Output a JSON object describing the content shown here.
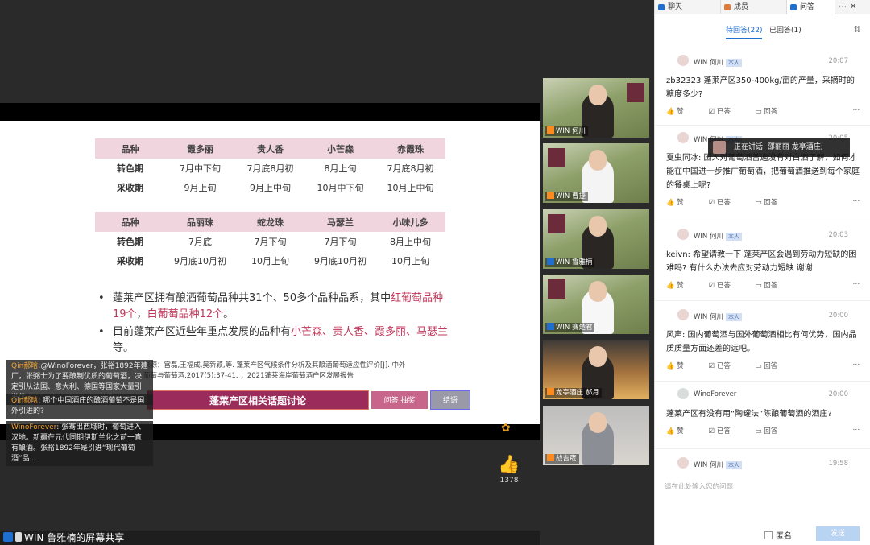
{
  "slide": {
    "table1": {
      "header": [
        "品种",
        "霞多丽",
        "贵人香",
        "小芒森",
        "赤霞珠"
      ],
      "rows": [
        [
          "转色期",
          "7月中下旬",
          "7月底8月初",
          "8月上旬",
          "7月底8月初"
        ],
        [
          "采收期",
          "9月上旬",
          "9月上中旬",
          "10月中下旬",
          "10月上中旬"
        ]
      ]
    },
    "table2": {
      "header": [
        "品种",
        "品丽珠",
        "蛇龙珠",
        "马瑟兰",
        "小味儿多"
      ],
      "rows": [
        [
          "转色期",
          "7月底",
          "7月下旬",
          "7月下旬",
          "8月上中旬"
        ],
        [
          "采收期",
          "9月底10月初",
          "10月上旬",
          "9月底10月初",
          "10月上旬"
        ]
      ]
    },
    "bullet1_a": "蓬莱产区拥有酿酒葡萄品种共31个、50多个品种品系，其中",
    "bullet1_b": "红葡萄品种19个",
    "bullet1_c": "，",
    "bullet1_d": "白葡萄品种12个",
    "bullet1_e": "。",
    "bullet2_a": "目前蓬莱产区近些年重点发展的品种有",
    "bullet2_b": "小芒森、贵人香、霞多丽、马瑟兰",
    "bullet2_c": "等。",
    "source": "来源：宫磊,王福成,吴新颖,等. 蓬莱产区气候条件分析及其酿酒葡萄适应性评价[J]. 中外葡萄与葡萄酒,2017(5):37-41. ；2021蓬莱海岸葡萄酒产区发展报告",
    "topic_label": "蓬莱产区相关话题讨论",
    "qa_button": "问答 抽奖",
    "end_button": "结语"
  },
  "chat_overlay": [
    {
      "name": "Qin郝晗",
      "text": ":@WinoForever，张裕1892年建厂，张弼士为了要酿制优质的葡萄酒，决定引从法国、意大利、德国等国家大量引进优..."
    },
    {
      "name": "Qin郝晗",
      "text": ": 哪个中国酒庄的酿酒葡萄不是国外引进的?"
    },
    {
      "name": "WinoForever",
      "text": ": 张骞出西域时，葡萄进入汉地。新疆在元代同期伊斯兰化之前一直有酿酒。张裕1892年是引进“现代葡萄酒”品..."
    }
  ],
  "likes": {
    "count": "1378"
  },
  "status_bar": {
    "text": "WIN 鲁雅楠的屏幕共享"
  },
  "videos": [
    {
      "name": "WIN 何川"
    },
    {
      "name": "WIN 曹捷"
    },
    {
      "name": "WIN 鲁雅楠"
    },
    {
      "name": "WIN 赛楚君"
    },
    {
      "name": "龙亭酒庄 郝月"
    },
    {
      "name": "战吉宬"
    }
  ],
  "panel": {
    "tabs": [
      "聊天",
      "成员",
      "问答"
    ],
    "controls": [
      "⋯",
      "✕"
    ],
    "pending": "待回答(22)",
    "answered": "已回答(1)",
    "sort_icon": "sort-icon",
    "speaking": "正在讲话: 邵丽丽 龙亭酒庄;",
    "compose_placeholder": "请在此处输入您的问题",
    "anonymous": "匿名",
    "send": "发送",
    "questions": [
      {
        "name": "WIN 何川",
        "tag": "本人",
        "time": "20:07",
        "text": "zb32323 蓬莱产区350-400kg/亩的产量，采摘时的糖度多少?"
      },
      {
        "name": "WIN 何川",
        "tag": "本人",
        "time": "20:05",
        "text": "夏虫同冰: 国人对葡萄酒普遍没有对白酒了解，如何才能在中国进一步推广葡萄酒，把葡萄酒推送到每个家庭的餐桌上呢?"
      },
      {
        "name": "WIN 何川",
        "tag": "本人",
        "time": "20:03",
        "text": "keivn: 希望请教一下 蓬莱产区会遇到劳动力短缺的困难吗? 有什么办法去应对劳动力短缺 谢谢"
      },
      {
        "name": "WIN 何川",
        "tag": "本人",
        "time": "20:00",
        "text": "风声: 国内葡萄酒与国外葡萄酒相比有何优势，国内品质质量方面还差的远吧。"
      },
      {
        "name": "WinoForever",
        "tag": "",
        "time": "20:00",
        "text": "蓬莱产区有没有用“陶罐法”陈酿葡萄酒的酒庄?"
      },
      {
        "name": "WIN 何川",
        "tag": "本人",
        "time": "19:58",
        "text": ""
      }
    ],
    "actions": {
      "like": "赞",
      "done": "已答",
      "reply": "回答",
      "more": "⋯"
    }
  }
}
